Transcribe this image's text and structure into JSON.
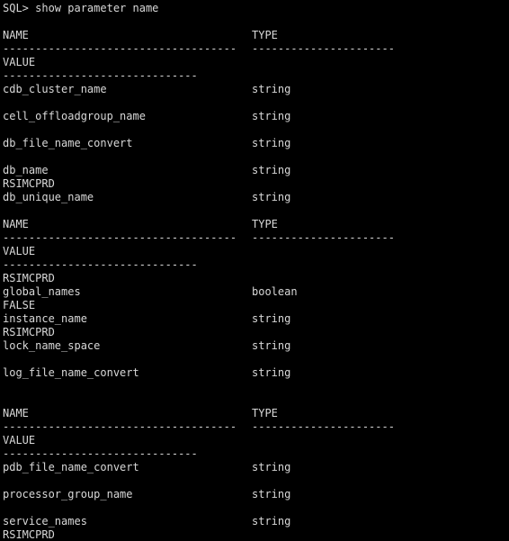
{
  "terminal": {
    "lines": [
      {
        "name": "SQL> show parameter name"
      },
      {
        "name": ""
      },
      {
        "name": "NAME",
        "type": "TYPE"
      },
      {
        "name": "------------------------------------",
        "type": "----------------------"
      },
      {
        "name": "VALUE"
      },
      {
        "name": "------------------------------"
      },
      {
        "name": "cdb_cluster_name",
        "type": "string"
      },
      {
        "name": ""
      },
      {
        "name": "cell_offloadgroup_name",
        "type": "string"
      },
      {
        "name": ""
      },
      {
        "name": "db_file_name_convert",
        "type": "string"
      },
      {
        "name": ""
      },
      {
        "name": "db_name",
        "type": "string"
      },
      {
        "name": "RSIMCPRD"
      },
      {
        "name": "db_unique_name",
        "type": "string"
      },
      {
        "name": ""
      },
      {
        "name": "NAME",
        "type": "TYPE"
      },
      {
        "name": "------------------------------------",
        "type": "----------------------"
      },
      {
        "name": "VALUE"
      },
      {
        "name": "------------------------------"
      },
      {
        "name": "RSIMCPRD"
      },
      {
        "name": "global_names",
        "type": "boolean"
      },
      {
        "name": "FALSE"
      },
      {
        "name": "instance_name",
        "type": "string"
      },
      {
        "name": "RSIMCPRD"
      },
      {
        "name": "lock_name_space",
        "type": "string"
      },
      {
        "name": ""
      },
      {
        "name": "log_file_name_convert",
        "type": "string"
      },
      {
        "name": ""
      },
      {
        "name": ""
      },
      {
        "name": "NAME",
        "type": "TYPE"
      },
      {
        "name": "------------------------------------",
        "type": "----------------------"
      },
      {
        "name": "VALUE"
      },
      {
        "name": "------------------------------"
      },
      {
        "name": "pdb_file_name_convert",
        "type": "string"
      },
      {
        "name": ""
      },
      {
        "name": "processor_group_name",
        "type": "string"
      },
      {
        "name": ""
      },
      {
        "name": "service_names",
        "type": "string"
      },
      {
        "name": "RSIMCPRD"
      },
      {
        "name": ""
      }
    ]
  },
  "colors": {
    "background": "#000000",
    "text": "#d8d8d8",
    "cursor": "#33d05a"
  }
}
